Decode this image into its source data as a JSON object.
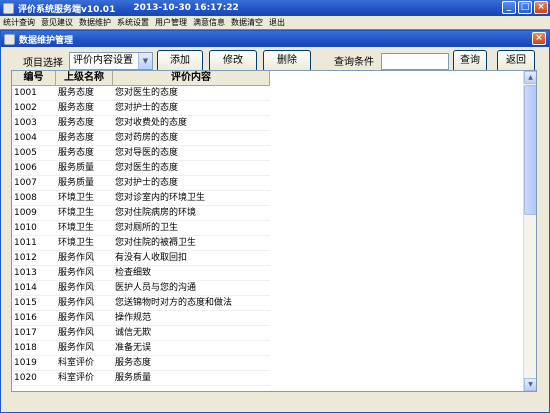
{
  "app": {
    "title": "评价系统服务端v10.01",
    "datetime": "2013-10-30 16:17:22",
    "min_label": "_",
    "max_label": "□",
    "close_label": "×"
  },
  "menu": [
    "统计查询",
    "意见建议",
    "数据维护",
    "系统设置",
    "用户管理",
    "满意信息",
    "数据清空",
    "退出"
  ],
  "child": {
    "title": "数据维护管理",
    "close_label": "×"
  },
  "toolbar": {
    "item_label": "项目选择",
    "item_value": "评价内容设置",
    "add": "添加",
    "edit": "修改",
    "delete": "删除",
    "query_label": "查询条件",
    "query_value": "",
    "query": "查询",
    "back": "返回"
  },
  "table": {
    "headers": [
      "编号",
      "上级名称",
      "评价内容"
    ],
    "rows": [
      [
        "1001",
        "服务态度",
        "您对医生的态度"
      ],
      [
        "1002",
        "服务态度",
        "您对护士的态度"
      ],
      [
        "1003",
        "服务态度",
        "您对收费处的态度"
      ],
      [
        "1004",
        "服务态度",
        "您对药房的态度"
      ],
      [
        "1005",
        "服务态度",
        "您对导医的态度"
      ],
      [
        "1006",
        "服务质量",
        "您对医生的态度"
      ],
      [
        "1007",
        "服务质量",
        "您对护士的态度"
      ],
      [
        "1008",
        "环境卫生",
        "您对诊室内的环境卫生"
      ],
      [
        "1009",
        "环境卫生",
        "您对住院病房的环境"
      ],
      [
        "1010",
        "环境卫生",
        "您对厕所的卫生"
      ],
      [
        "1011",
        "环境卫生",
        "您对住院的被褥卫生"
      ],
      [
        "1012",
        "服务作风",
        "有没有人收取回扣"
      ],
      [
        "1013",
        "服务作风",
        "检查细致"
      ],
      [
        "1014",
        "服务作风",
        "医护人员与您的沟通"
      ],
      [
        "1015",
        "服务作风",
        "您送锦物时对方的态度和做法"
      ],
      [
        "1016",
        "服务作风",
        "操作规范"
      ],
      [
        "1017",
        "服务作风",
        "诚信无欺"
      ],
      [
        "1018",
        "服务作风",
        "准备无误"
      ],
      [
        "1019",
        "科室评价",
        "服务态度"
      ],
      [
        "1020",
        "科室评价",
        "服务质量"
      ]
    ]
  }
}
